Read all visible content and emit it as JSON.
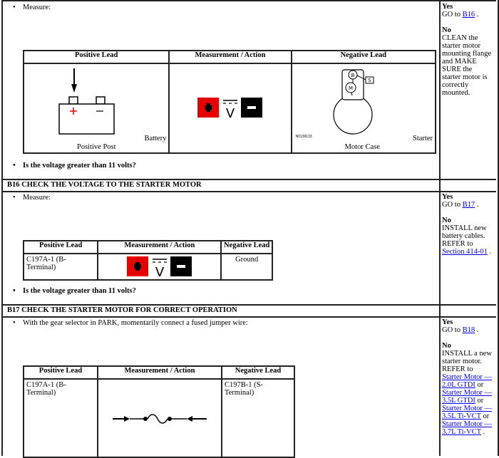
{
  "step_b15": {
    "measure_label": "Measure:",
    "table": {
      "headers": [
        "Positive Lead",
        "Measurement / Action",
        "Negative Lead"
      ],
      "battery_label": "Battery",
      "positive_post_label": "Positive Post",
      "starter_label": "Starter",
      "motor_case_label": "Motor Case",
      "figure_code": "N0139133",
      "b_terminal_letter": "B",
      "m_terminal_letter": "M",
      "s_terminal_letter": "S"
    },
    "question": "Is the voltage greater than 11 volts?",
    "result": {
      "yes_label": "Yes",
      "yes_go": "GO to",
      "yes_link": "B16",
      "no_label": "No",
      "no_lines": [
        "CLEAN the",
        "starter motor",
        "mounting flange",
        "and MAKE",
        "SURE the",
        "starter motor is",
        "correctly",
        "mounted."
      ]
    }
  },
  "step_b16": {
    "title": "B16 CHECK THE VOLTAGE TO THE STARTER MOTOR",
    "measure_label": "Measure:",
    "table": {
      "headers": [
        "Positive Lead",
        "Measurement / Action",
        "Negative Lead"
      ],
      "positive": "C197A-1 (B-Terminal)",
      "negative": "Ground"
    },
    "question": "Is the voltage greater than 11 volts?",
    "result": {
      "yes_label": "Yes",
      "yes_go": "GO to",
      "yes_link": "B17",
      "no_label": "No",
      "no_lines": [
        "INSTALL new",
        "battery cables.",
        "REFER to"
      ],
      "no_link": "Section 414-01"
    }
  },
  "step_b17": {
    "title": "B17 CHECK THE STARTER MOTOR FOR CORRECT OPERATION",
    "instruction": "With the gear selector in PARK, momentarily connect a fused jumper wire:",
    "table": {
      "headers": [
        "Positive Lead",
        "Measurement / Action",
        "Negative Lead"
      ],
      "positive": "C197A-1 (B-Terminal)",
      "negative": "C197B-1 (S-Terminal)"
    },
    "result": {
      "yes_label": "Yes",
      "yes_go": "GO to",
      "yes_link": "B18",
      "no_label": "No",
      "no_lines": [
        "INSTALL a new",
        "starter motor.",
        "REFER to"
      ],
      "links": [
        {
          "line1": "Starter Motor —",
          "line2": "2.0L GTDI",
          "suffix": " or"
        },
        {
          "line1": "Starter Motor —",
          "line2": "3.5L GTDI",
          "suffix": " or"
        },
        {
          "line1": "Starter Motor —",
          "line2": "3.5L Ti-VCT",
          "suffix": " or"
        },
        {
          "line1": "Starter Motor —",
          "line2": "3.7L Ti-VCT",
          "suffix": " ."
        }
      ]
    }
  }
}
